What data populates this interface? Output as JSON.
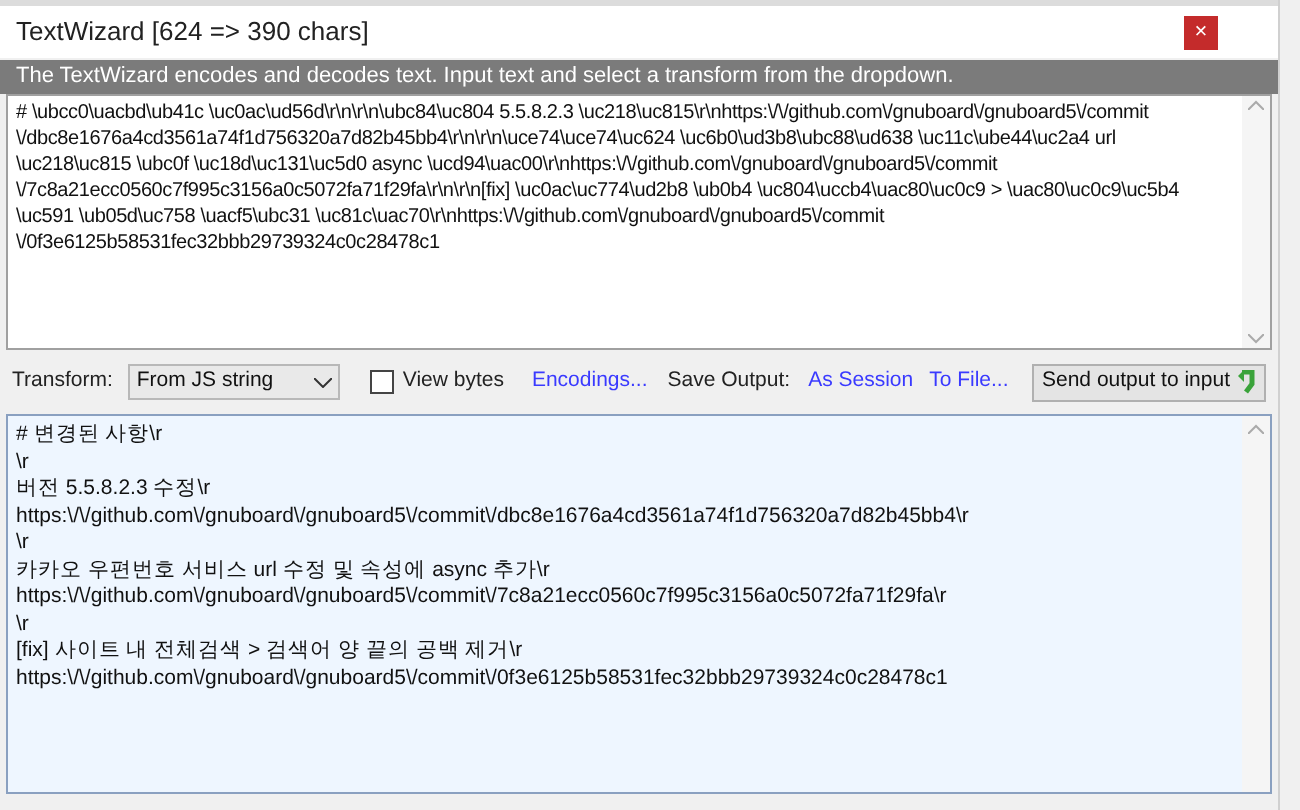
{
  "window": {
    "title": "TextWizard [624 => 390 chars]",
    "close": "×"
  },
  "description": "The TextWizard encodes and decodes text. Input text and select a transform from the dropdown.",
  "input": {
    "lines": [
      "# \\ubcc0\\uacbd\\ub41c \\uc0ac\\ud56d\\r\\n\\r\\n\\ubc84\\uc804 5.5.8.2.3 \\uc218\\uc815\\r\\nhttps:\\/\\/github.com\\/gnuboard\\/gnuboard5\\/commit",
      "\\/dbc8e1676a4cd3561a74f1d756320a7d82b45bb4\\r\\n\\r\\n\\uce74\\uce74\\uc624 \\uc6b0\\ud3b8\\ubc88\\ud638 \\uc11c\\ube44\\uc2a4 url",
      "\\uc218\\uc815 \\ubc0f \\uc18d\\uc131\\uc5d0 async \\ucd94\\uac00\\r\\nhttps:\\/\\/github.com\\/gnuboard\\/gnuboard5\\/commit",
      "\\/7c8a21ecc0560c7f995c3156a0c5072fa71f29fa\\r\\n\\r\\n[fix] \\uc0ac\\uc774\\ud2b8 \\ub0b4 \\uc804\\uccb4\\uac80\\uc0c9 > \\uac80\\uc0c9\\uc5b4",
      "\\uc591 \\ub05d\\uc758 \\uacf5\\ubc31 \\uc81c\\uac70\\r\\nhttps:\\/\\/github.com\\/gnuboard\\/gnuboard5\\/commit",
      "\\/0f3e6125b58531fec32bbb29739324c0c28478c1"
    ]
  },
  "toolbar": {
    "transform_label": "Transform:",
    "transform_value": "From JS string",
    "view_bytes": {
      "label": "View bytes",
      "checked": false
    },
    "encodings_link": "Encodings...",
    "save_label": "Save Output:",
    "save_links": [
      "As Session",
      "To File..."
    ],
    "send_button": "Send output to input"
  },
  "output": {
    "lines": [
      "# 변경된 사항\\r",
      "\\r",
      "버전 5.5.8.2.3 수정\\r",
      "https:\\/\\/github.com\\/gnuboard\\/gnuboard5\\/commit\\/dbc8e1676a4cd3561a74f1d756320a7d82b45bb4\\r",
      "\\r",
      "카카오 우편번호 서비스 url 수정 및 속성에 async 추가\\r",
      "https:\\/\\/github.com\\/gnuboard\\/gnuboard5\\/commit\\/7c8a21ecc0560c7f995c3156a0c5072fa71f29fa\\r",
      "\\r",
      "[fix] 사이트 내 전체검색 > 검색어 양 끝의 공백 제거\\r",
      "https:\\/\\/github.com\\/gnuboard\\/gnuboard5\\/commit\\/0f3e6125b58531fec32bbb29739324c0c28478c1"
    ]
  }
}
